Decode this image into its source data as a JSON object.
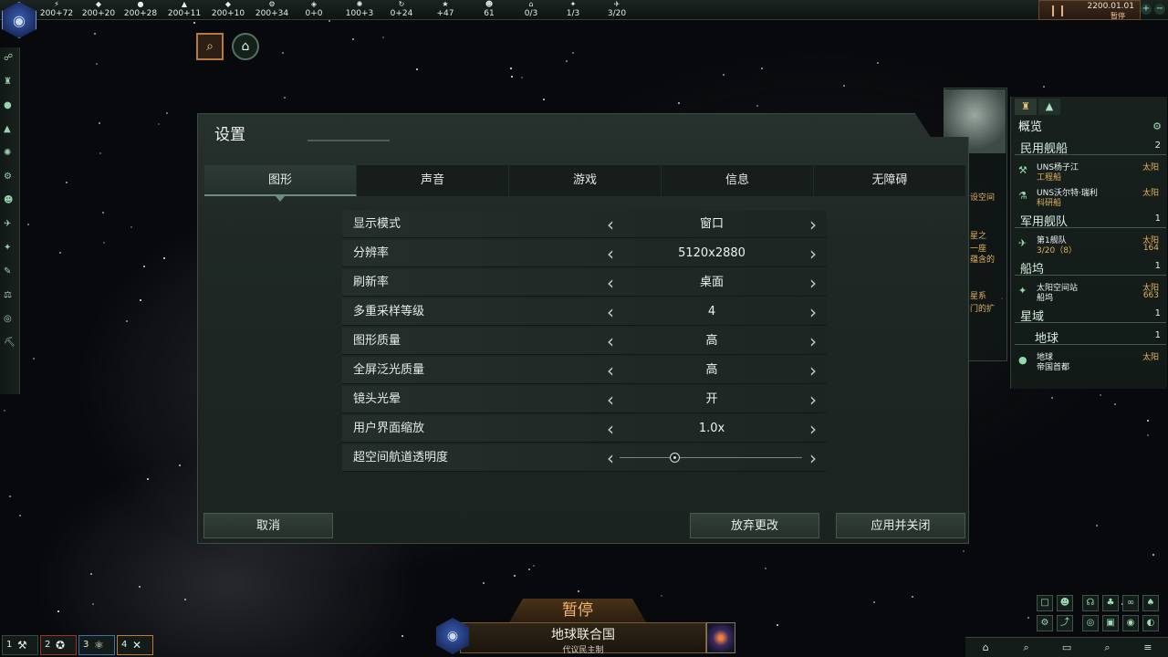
{
  "topbar": {
    "resources": [
      {
        "icon": "energy-icon",
        "glyph": "⚡",
        "value": "200+72"
      },
      {
        "icon": "minerals-icon",
        "glyph": "◆",
        "value": "200+20"
      },
      {
        "icon": "food-icon",
        "glyph": "●",
        "value": "200+28"
      },
      {
        "icon": "consumer-goods-icon",
        "glyph": "▲",
        "value": "200+11"
      },
      {
        "icon": "alloys-icon",
        "glyph": "◆",
        "value": "200+10"
      },
      {
        "icon": "engineering-icon",
        "glyph": "⚙",
        "value": "200+34"
      },
      {
        "icon": "influence-icon",
        "glyph": "◈",
        "value": "0+0"
      },
      {
        "icon": "unity-icon",
        "glyph": "✺",
        "value": "100+3"
      },
      {
        "icon": "research-icon",
        "glyph": "↻",
        "value": "0+24"
      },
      {
        "icon": "amenities-icon",
        "glyph": "★",
        "value": "+47"
      },
      {
        "icon": "pops-icon",
        "glyph": "☻",
        "value": "61"
      },
      {
        "icon": "housing-icon",
        "glyph": "⌂",
        "value": "0/3"
      },
      {
        "icon": "starbase-icon",
        "glyph": "✦",
        "value": "1/3"
      },
      {
        "icon": "fleet-icon",
        "glyph": "✈",
        "value": "3/20"
      }
    ],
    "date": "2200.01.01",
    "status": "暂停"
  },
  "dialog": {
    "title": "设置",
    "tabs": [
      "图形",
      "声音",
      "游戏",
      "信息",
      "无障碍"
    ],
    "active_tab": 0,
    "settings": [
      {
        "label": "显示模式",
        "value": "窗口"
      },
      {
        "label": "分辨率",
        "value": "5120x2880"
      },
      {
        "label": "刷新率",
        "value": "桌面"
      },
      {
        "label": "多重采样等级",
        "value": "4"
      },
      {
        "label": "图形质量",
        "value": "高"
      },
      {
        "label": "全屏泛光质量",
        "value": "高"
      },
      {
        "label": "镜头光晕",
        "value": "开"
      },
      {
        "label": "用户界面缩放",
        "value": "1.0x"
      }
    ],
    "slider": {
      "label": "超空间航道透明度",
      "value": 0.3
    },
    "buttons": {
      "cancel": "取消",
      "discard": "放弃更改",
      "apply": "应用并关闭"
    }
  },
  "outliner": {
    "title": "概览",
    "civilian": {
      "header": "民用舰船",
      "count": "2",
      "items": [
        {
          "name": "UNS杨子江",
          "type": "工程船",
          "loc": "太阳"
        },
        {
          "name": "UNS沃尔特·瑞利",
          "type": "科研船",
          "loc": "太阳"
        }
      ]
    },
    "military": {
      "header": "军用舰队",
      "count": "1",
      "items": [
        {
          "name": "第1舰队",
          "type": "3/20（8）",
          "loc": "太阳",
          "power": "164"
        }
      ]
    },
    "starbase": {
      "header": "船坞",
      "count": "1",
      "items": [
        {
          "name": "太阳空间站",
          "type": "船坞",
          "loc": "太阳",
          "power": "663"
        }
      ]
    },
    "sector": {
      "header": "星域",
      "count": "1"
    },
    "planet": {
      "header": "地球",
      "count": "1",
      "items": [
        {
          "name": "地球",
          "type": "帝国首都",
          "loc": "太阳"
        }
      ]
    }
  },
  "situation_fragments": [
    "设空间",
    "星之",
    "一座",
    "蕴含的",
    "星系",
    "门的扩"
  ],
  "bottom": {
    "paused": "暂停",
    "empire_name": "地球联合国",
    "government": "代议民主制",
    "groups": [
      "1",
      "2",
      "3",
      "4"
    ]
  }
}
